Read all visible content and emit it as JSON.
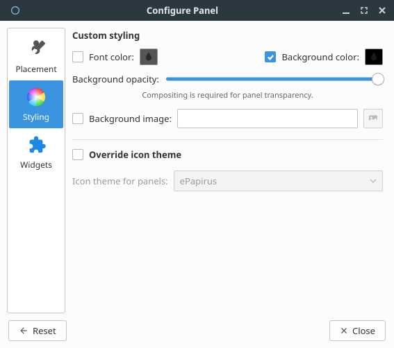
{
  "window": {
    "title": "Configure Panel"
  },
  "sidebar": {
    "items": [
      {
        "label": "Placement"
      },
      {
        "label": "Styling"
      },
      {
        "label": "Widgets"
      }
    ],
    "selected_index": 1
  },
  "styling": {
    "section_title": "Custom styling",
    "font_color_label": "Font color:",
    "font_color_checked": false,
    "background_color_label": "Background color:",
    "background_color_checked": true,
    "background_opacity_label": "Background opacity:",
    "background_opacity_value": 100,
    "compositing_hint": "Compositing is required for panel transparency.",
    "background_image_label": "Background image:",
    "background_image_checked": false,
    "background_image_path": "",
    "override_icon_theme_label": "Override icon theme",
    "override_icon_theme_checked": false,
    "icon_theme_label": "Icon theme for panels:",
    "icon_theme_value": "ePapirus"
  },
  "footer": {
    "reset_label": "Reset",
    "close_label": "Close"
  }
}
